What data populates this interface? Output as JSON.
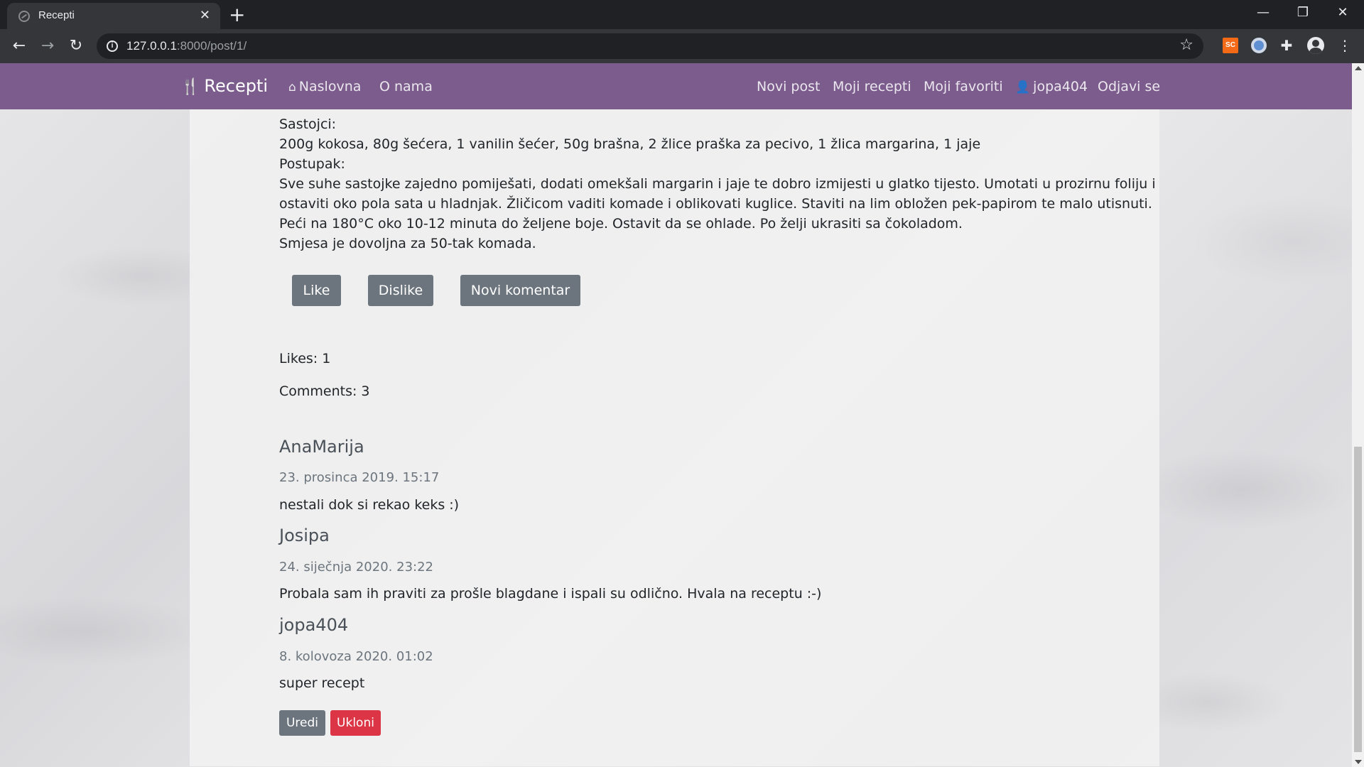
{
  "browser": {
    "tab_title": "Recepti",
    "tab_close": "✕",
    "new_tab": "+",
    "url_host": "127.0.0.1",
    "url_rest": ":8000/post/1/",
    "window_min": "—",
    "window_max": "❐",
    "window_close": "✕",
    "ext_sc_label": "SC"
  },
  "navbar": {
    "brand": "Recepti",
    "home": "Naslovna",
    "about": "O nama",
    "new_post": "Novi post",
    "my_recipes": "Moji recepti",
    "my_favorites": "Moji favoriti",
    "username": "jopa404",
    "logout": "Odjavi se",
    "color": "#7b5c8c"
  },
  "recipe": {
    "ingredients_label": "Sastojci:",
    "ingredients": "200g kokosa, 80g šećera, 1 vanilin šećer, 50g brašna, 2 žlice praška za pecivo, 1 žlica margarina, 1 jaje",
    "method_label": "Postupak:",
    "method": "Sve suhe sastojke zajedno pomiješati, dodati omekšali margarin i jaje te dobro izmijesti u glatko tijesto. Umotati u prozirnu foliju i ostaviti oko pola sata u hladnjak. Žličicom vaditi komade i oblikovati kuglice. Staviti na lim obložen pek-papirom te malo utisnuti. Peći na 180°C oko 10-12 minuta do željene boje. Ostavit da se ohlade. Po želji ukrasiti sa čokoladom.",
    "note": "Smjesa je dovoljna za 50-tak komada."
  },
  "actions": {
    "like": "Like",
    "dislike": "Dislike",
    "new_comment": "Novi komentar"
  },
  "stats": {
    "likes": "Likes: 1",
    "comments": "Comments: 3"
  },
  "comments": [
    {
      "author": "AnaMarija",
      "date": "23. prosinca 2019. 15:17",
      "text": "nestali dok si rekao keks :)"
    },
    {
      "author": "Josipa",
      "date": "24. siječnja 2020. 23:22",
      "text": "Probala sam ih praviti za prošle blagdane i ispali su odlično. Hvala na receptu :-)"
    },
    {
      "author": "jopa404",
      "date": "8. kolovoza 2020. 01:02",
      "text": "super recept"
    }
  ],
  "comment_actions": {
    "edit": "Uredi",
    "delete": "Ukloni"
  },
  "icons": {
    "back": "back-arrow-icon",
    "forward": "forward-arrow-icon",
    "reload": "reload-icon",
    "info": "info-icon",
    "star": "star-icon",
    "brand": "cutlery-icon",
    "home": "home-icon",
    "user": "user-icon"
  }
}
